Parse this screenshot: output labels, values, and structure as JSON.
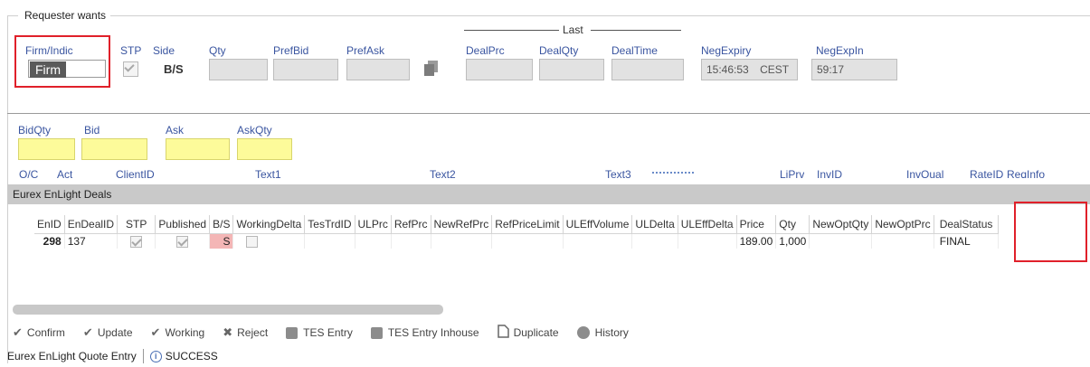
{
  "requester": {
    "group_title": "Requester wants",
    "firm_indic_label": "Firm/Indic",
    "firm_indic_value": "Firm",
    "stp_label": "STP",
    "side_label": "Side",
    "side_value": "B/S",
    "qty_label": "Qty",
    "prefbid_label": "PrefBid",
    "prefask_label": "PrefAsk",
    "last_label": "Last",
    "dealprc_label": "DealPrc",
    "dealqty_label": "DealQty",
    "dealtime_label": "DealTime",
    "negexpiry_label": "NegExpiry",
    "negexpiry_value": "15:46:53",
    "negexpiry_tz": "CEST",
    "negexpin_label": "NegExpIn",
    "negexpin_value": "59:17"
  },
  "quote": {
    "bidqty_label": "BidQty",
    "bid_label": "Bid",
    "ask_label": "Ask",
    "askqty_label": "AskQty"
  },
  "partial_row": [
    "O/C",
    "Act",
    "ClientID",
    "Text1",
    "Text2",
    "Text3",
    "LiPrv",
    "InvID",
    "InvQual",
    "RateID",
    "ReqInfo"
  ],
  "grid": {
    "title": "Eurex EnLight Deals",
    "columns": [
      "EnID",
      "EnDealID",
      "STP",
      "Published",
      "B/S",
      "WorkingDelta",
      "TesTrdID",
      "ULPrc",
      "RefPrc",
      "NewRefPrc",
      "RefPriceLimit",
      "ULEffVolume",
      "ULDelta",
      "ULEffDelta",
      "Price",
      "Qty",
      "NewOptQty",
      "NewOptPrc",
      "DealStatus"
    ],
    "row": {
      "enid": "298",
      "endealid": "137",
      "bs": "S",
      "price": "189.00",
      "qty": "1,000",
      "dealstatus": "FINAL"
    }
  },
  "toolbar": {
    "confirm": "Confirm",
    "update": "Update",
    "working": "Working",
    "reject": "Reject",
    "tes_entry": "TES Entry",
    "tes_entry_inhouse": "TES Entry Inhouse",
    "duplicate": "Duplicate",
    "history": "History"
  },
  "status": {
    "app_name": "Eurex EnLight Quote Entry",
    "message": "SUCCESS"
  },
  "colors": {
    "highlight_red": "#e0202a",
    "quote_yellow": "#fdfb9a",
    "sell_pink": "#f4b6b6",
    "label_blue": "#3a55a0"
  }
}
